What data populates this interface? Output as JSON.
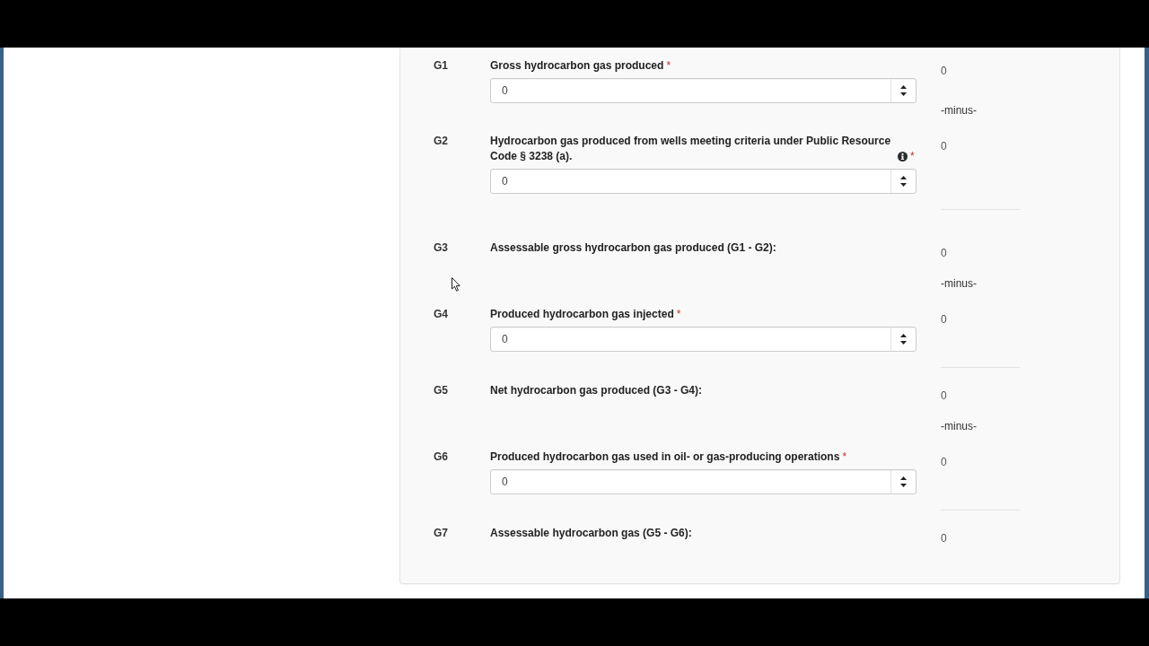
{
  "form": {
    "rows": [
      {
        "code": "G1",
        "kind": "input",
        "label": "Gross hydrocarbon gas produced",
        "required_mark": "*",
        "field": {
          "value": "0"
        },
        "result": "0",
        "note": "-minus-"
      },
      {
        "code": "G2",
        "kind": "input",
        "label": "Hydrocarbon gas produced from wells meeting criteria under Public Resource Code § 3238 (a).",
        "info": true,
        "required_mark": "*",
        "field": {
          "value": "0"
        },
        "result": "0",
        "rule_below": true
      },
      {
        "code": "G3",
        "kind": "total",
        "label": "Assessable gross hydrocarbon gas produced (G1 - G2):",
        "result": "0",
        "note": "-minus-"
      },
      {
        "code": "G4",
        "kind": "input",
        "label": "Produced hydrocarbon gas injected",
        "required_mark": "*",
        "field": {
          "value": "0"
        },
        "result": "0",
        "rule_below": true
      },
      {
        "code": "G5",
        "kind": "total",
        "label": "Net hydrocarbon gas produced (G3 - G4):",
        "result": "0",
        "note": "-minus-"
      },
      {
        "code": "G6",
        "kind": "input",
        "label": "Produced hydrocarbon gas used in oil- or gas-producing operations",
        "required_mark": "*",
        "field": {
          "value": "0"
        },
        "result": "0",
        "rule_below": true
      },
      {
        "code": "G7",
        "kind": "total",
        "label": "Assessable hydrocarbon gas (G5 - G6):",
        "result": "0"
      }
    ]
  }
}
